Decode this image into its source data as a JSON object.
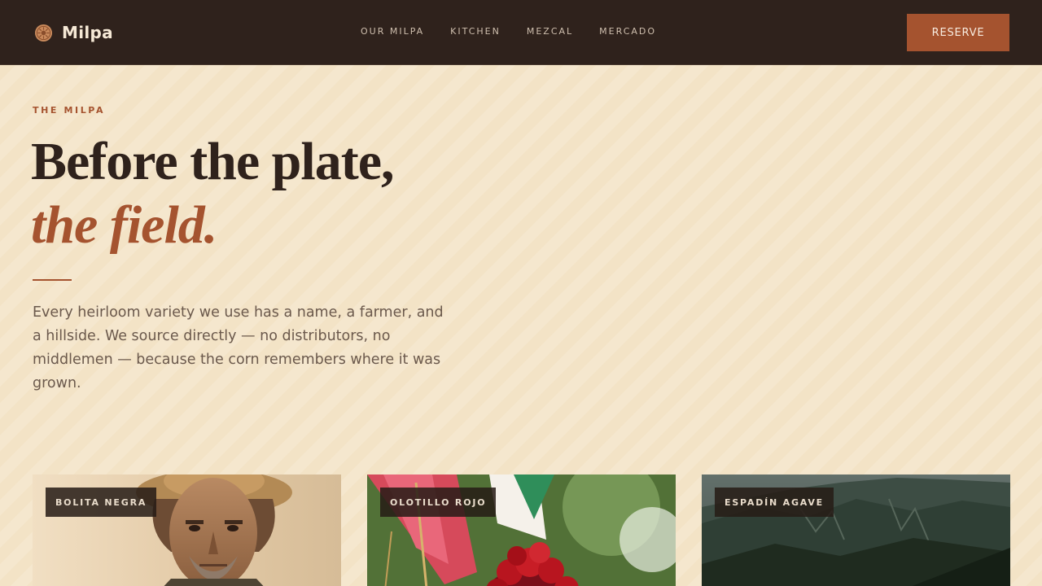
{
  "brand": {
    "name": "Milpa",
    "icon": "sunflower-seal-icon"
  },
  "nav": [
    {
      "label": "OUR MILPA"
    },
    {
      "label": "KITCHEN"
    },
    {
      "label": "MEZCAL"
    },
    {
      "label": "MERCADO"
    }
  ],
  "reserve_label": "RESERVE",
  "hero": {
    "eyebrow": "THE MILPA",
    "headline_line1": "Before the plate,",
    "headline_line2": "the field.",
    "intro": "Every heirloom variety we use has a name, a farmer, and a hillside. We source directly — no distributors, no middlemen — because the corn remembers where it was grown."
  },
  "cards": [
    {
      "tag": "BOLITA NEGRA"
    },
    {
      "tag": "OLOTILLO ROJO"
    },
    {
      "tag": "ESPADÍN AGAVE"
    }
  ],
  "colors": {
    "accent": "#a5532f",
    "header_bg": "#2f221c",
    "page_bg": "#f3e3c6",
    "heading": "#2f221c"
  }
}
